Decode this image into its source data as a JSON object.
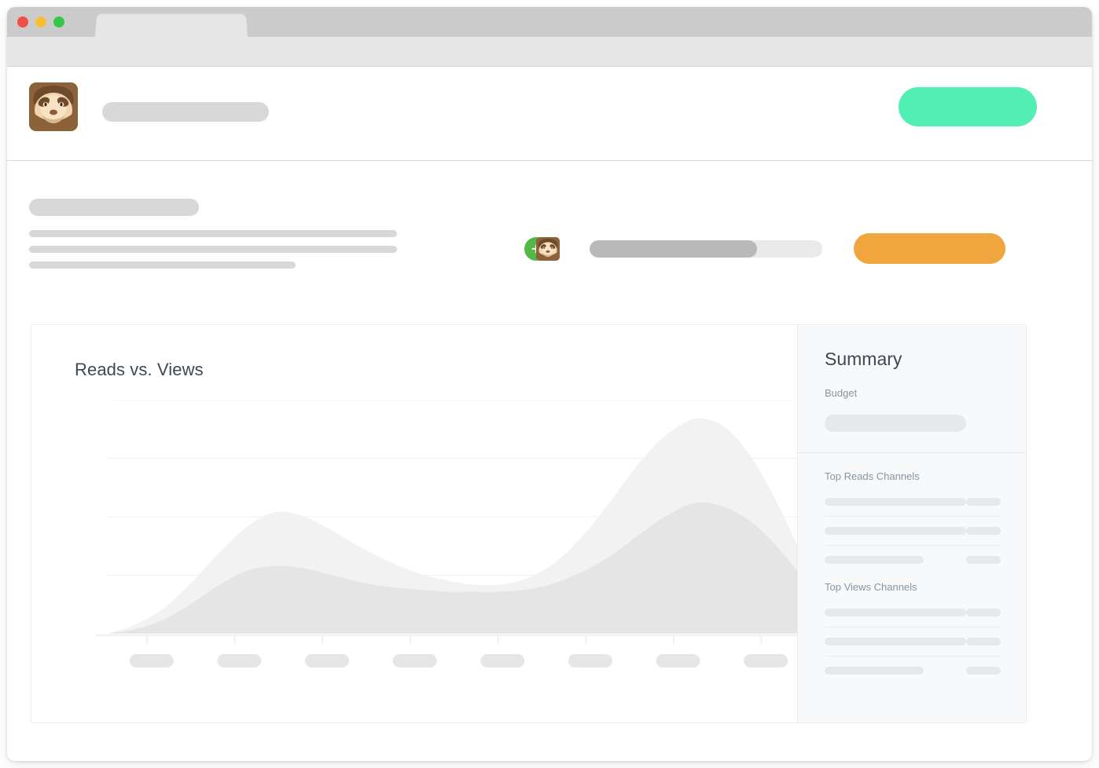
{
  "window": {
    "traffic_lights": [
      "close",
      "minimize",
      "maximize"
    ],
    "colors": {
      "close": "#ef4f45",
      "minimize": "#f5bf2f",
      "maximize": "#34c748"
    },
    "tab_title": ""
  },
  "header": {
    "logo_icon": "sloth-avatar-icon",
    "title_placeholder": "",
    "cta_label": "",
    "cta_color": "#51efb1"
  },
  "description": {
    "title_placeholder": "",
    "lines": [
      "",
      "",
      ""
    ]
  },
  "controls": {
    "add_icon": "plus-icon",
    "add_color": "#53b848",
    "assignee_icon": "sloth-avatar-icon",
    "progress": {
      "value": 72,
      "fill_color": "#b9b9b9",
      "track_color": "#eaeaea"
    },
    "action_label": "",
    "action_color": "#f0a53f"
  },
  "summary": {
    "heading": "Summary",
    "budget_label": "Budget",
    "budget_value": "",
    "sections": [
      {
        "label": "Top Reads Channels",
        "rows": [
          {
            "name": "",
            "value": "",
            "width": "long"
          },
          {
            "name": "",
            "value": "",
            "width": "long"
          },
          {
            "name": "",
            "value": "",
            "width": "short"
          }
        ]
      },
      {
        "label": "Top Views Channels",
        "rows": [
          {
            "name": "",
            "value": "",
            "width": "long"
          },
          {
            "name": "",
            "value": "",
            "width": "long"
          },
          {
            "name": "",
            "value": "",
            "width": "short"
          }
        ]
      }
    ]
  },
  "chart_data": {
    "type": "area",
    "title": "Reads vs. Views",
    "xlabel": "",
    "ylabel": "",
    "grid": true,
    "legend": "none",
    "ylim": [
      0,
      100
    ],
    "gridline_values": [
      100,
      75,
      50,
      25
    ],
    "x_tick_count": 8,
    "x_tick_labels": [
      "",
      "",
      "",
      "",
      "",
      "",
      "",
      ""
    ],
    "x": [
      0,
      4,
      8,
      12,
      16,
      20,
      24,
      28,
      32,
      36,
      40,
      44,
      48,
      52,
      56,
      60,
      64,
      68,
      72,
      76,
      80,
      84,
      88,
      92,
      96,
      100
    ],
    "series": [
      {
        "name": "Views",
        "color": "#f1f1f1",
        "values": [
          0,
          4,
          11,
          22,
          35,
          46,
          52,
          50,
          44,
          37,
          31,
          26,
          23,
          21,
          21,
          24,
          31,
          43,
          58,
          74,
          86,
          92,
          88,
          74,
          52,
          26
        ]
      },
      {
        "name": "Reads",
        "color": "#e4e4e4",
        "values": [
          0,
          2,
          6,
          13,
          21,
          27,
          29,
          28,
          25,
          22,
          20,
          19,
          18,
          18,
          18,
          19,
          22,
          27,
          34,
          43,
          51,
          56,
          54,
          47,
          35,
          20
        ]
      }
    ]
  }
}
